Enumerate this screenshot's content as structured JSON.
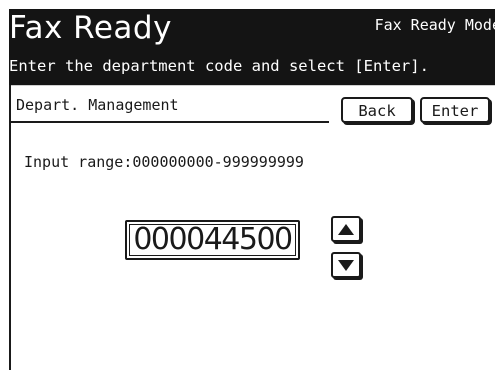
{
  "header": {
    "title": "Fax Ready",
    "mode": "Fax Ready Mode",
    "instruction": "Enter the department code and select [Enter]."
  },
  "screen": {
    "title": "Depart. Management",
    "back_label": "Back",
    "enter_label": "Enter",
    "input_range": "Input range:000000000-999999999",
    "code_value": "000044500"
  },
  "icons": {
    "up": "arrow-up-icon",
    "down": "arrow-down-icon"
  },
  "colors": {
    "header_bg": "#141414",
    "header_text": "#ffffff",
    "panel_bg": "#ffffff",
    "text": "#1a1a1a"
  }
}
